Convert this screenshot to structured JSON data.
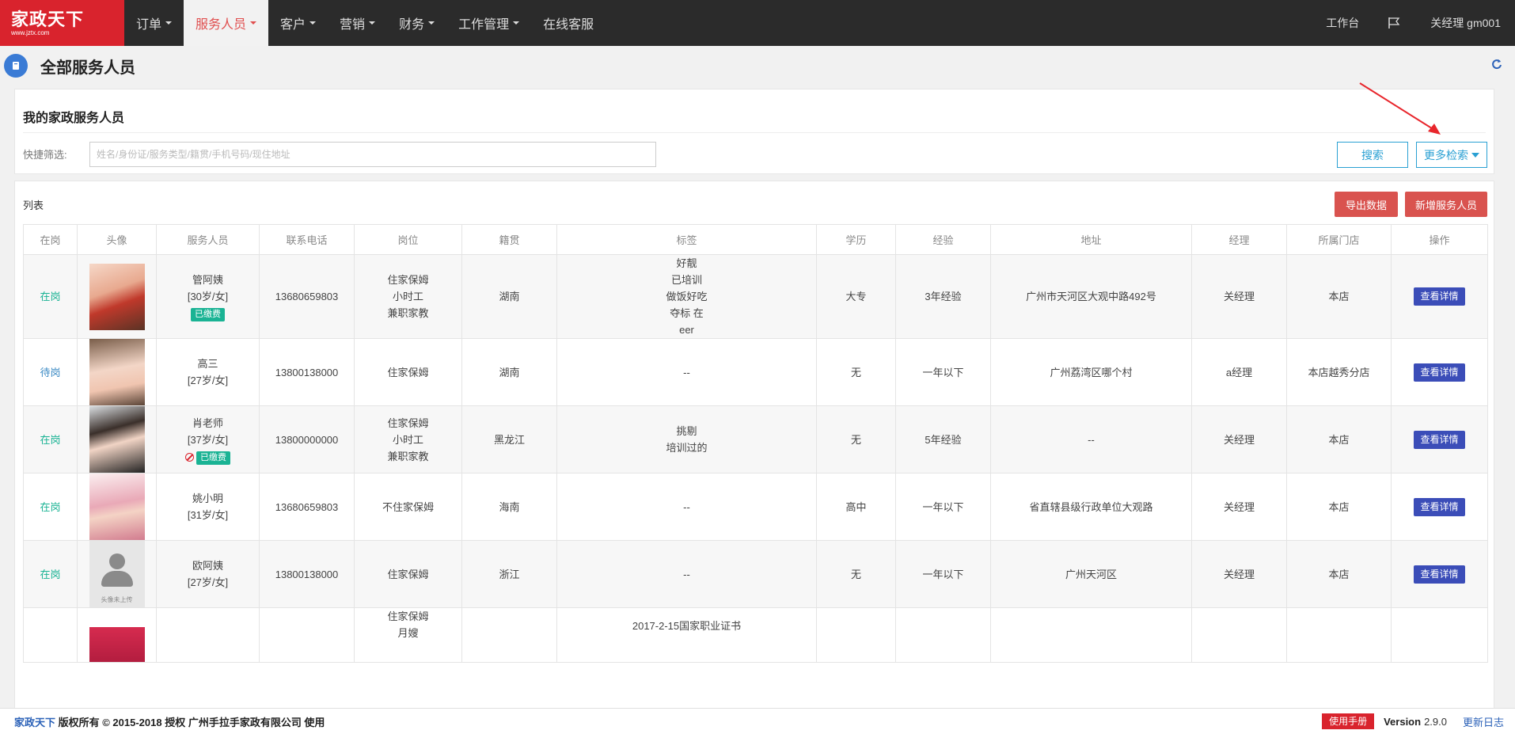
{
  "nav": {
    "logo_text": "家政天下",
    "logo_sub": "www.jztx.com",
    "items": [
      {
        "label": "订单",
        "dropdown": true,
        "active": false
      },
      {
        "label": "服务人员",
        "dropdown": true,
        "active": true
      },
      {
        "label": "客户",
        "dropdown": true,
        "active": false
      },
      {
        "label": "营销",
        "dropdown": true,
        "active": false
      },
      {
        "label": "财务",
        "dropdown": true,
        "active": false
      },
      {
        "label": "工作管理",
        "dropdown": true,
        "active": false
      },
      {
        "label": "在线客服",
        "dropdown": false,
        "active": false
      }
    ],
    "workbench": "工作台",
    "user": "关经理 gm001",
    "accent_color": "#d9232d"
  },
  "page": {
    "title": "全部服务人员"
  },
  "filter_panel": {
    "title": "我的家政服务人员",
    "quick_filter_label": "快捷筛选:",
    "search_placeholder": "姓名/身份证/服务类型/籍贯/手机号码/现住地址",
    "search_button": "搜索",
    "more_search_button": "更多检索"
  },
  "list_panel": {
    "title": "列表",
    "export_button": "导出数据",
    "add_button": "新增服务人员",
    "columns": [
      "在岗",
      "头像",
      "服务人员",
      "联系电话",
      "岗位",
      "籍贯",
      "标签",
      "学历",
      "经验",
      "地址",
      "经理",
      "所属门店",
      "操作"
    ],
    "rows": [
      {
        "status": "在岗",
        "status_type": "on",
        "name": "管阿姨",
        "age_gender": "[30岁/女]",
        "paid": "已缴费",
        "banned": false,
        "phone": "13680659803",
        "jobs": [
          "住家保姆",
          "小时工",
          "兼职家教"
        ],
        "origin": "湖南",
        "tags": [
          "好靓",
          "已培训",
          "做饭好吃",
          "夺标 在",
          "eer"
        ],
        "education": "大专",
        "experience": "3年经验",
        "address": "广州市天河区大观中路492号",
        "manager": "关经理",
        "store": "本店",
        "action": "查看详情"
      },
      {
        "status": "待岗",
        "status_type": "wait",
        "name": "高三",
        "age_gender": "[27岁/女]",
        "paid": "",
        "banned": false,
        "phone": "13800138000",
        "jobs": [
          "住家保姆"
        ],
        "origin": "湖南",
        "tags": [
          "--"
        ],
        "education": "无",
        "experience": "一年以下",
        "address": "广州荔湾区哪个村",
        "manager": "a经理",
        "store": "本店越秀分店",
        "action": "查看详情"
      },
      {
        "status": "在岗",
        "status_type": "on",
        "name": "肖老师",
        "age_gender": "[37岁/女]",
        "paid": "已缴费",
        "banned": true,
        "phone": "13800000000",
        "jobs": [
          "住家保姆",
          "小时工",
          "兼职家教"
        ],
        "origin": "黑龙江",
        "tags": [
          "挑剔",
          "培训过的"
        ],
        "education": "无",
        "experience": "5年经验",
        "address": "--",
        "manager": "关经理",
        "store": "本店",
        "action": "查看详情"
      },
      {
        "status": "在岗",
        "status_type": "on",
        "name": "姚小明",
        "age_gender": "[31岁/女]",
        "paid": "",
        "banned": false,
        "phone": "13680659803",
        "jobs": [
          "不住家保姆"
        ],
        "origin": "海南",
        "tags": [
          "--"
        ],
        "education": "高中",
        "experience": "一年以下",
        "address": "省直辖县级行政单位大观路",
        "manager": "关经理",
        "store": "本店",
        "action": "查看详情"
      },
      {
        "status": "在岗",
        "status_type": "on",
        "name": "欧阿姨",
        "age_gender": "[27岁/女]",
        "paid": "",
        "banned": false,
        "phone": "13800138000",
        "jobs": [
          "住家保姆"
        ],
        "origin": "浙江",
        "tags": [
          "--"
        ],
        "education": "无",
        "experience": "一年以下",
        "address": "广州天河区",
        "manager": "关经理",
        "store": "本店",
        "action": "查看详情",
        "avatar_caption": "头像未上传"
      },
      {
        "status": "",
        "status_type": "on",
        "name": "",
        "age_gender": "",
        "paid": "",
        "banned": false,
        "phone": "",
        "jobs": [
          "住家保姆",
          "月嫂"
        ],
        "origin": "",
        "tags": [
          "2017-2-15国家职业证书"
        ],
        "education": "",
        "experience": "",
        "address": "",
        "manager": "",
        "store": "",
        "action": ""
      }
    ]
  },
  "footer": {
    "brand": "家政天下",
    "copyright": " 版权所有 © 2015-2018 授权 广州手拉手家政有限公司 使用",
    "manual": "使用手册",
    "version_label": "Version",
    "version_number": "2.9.0",
    "changelog": "更新日志"
  }
}
